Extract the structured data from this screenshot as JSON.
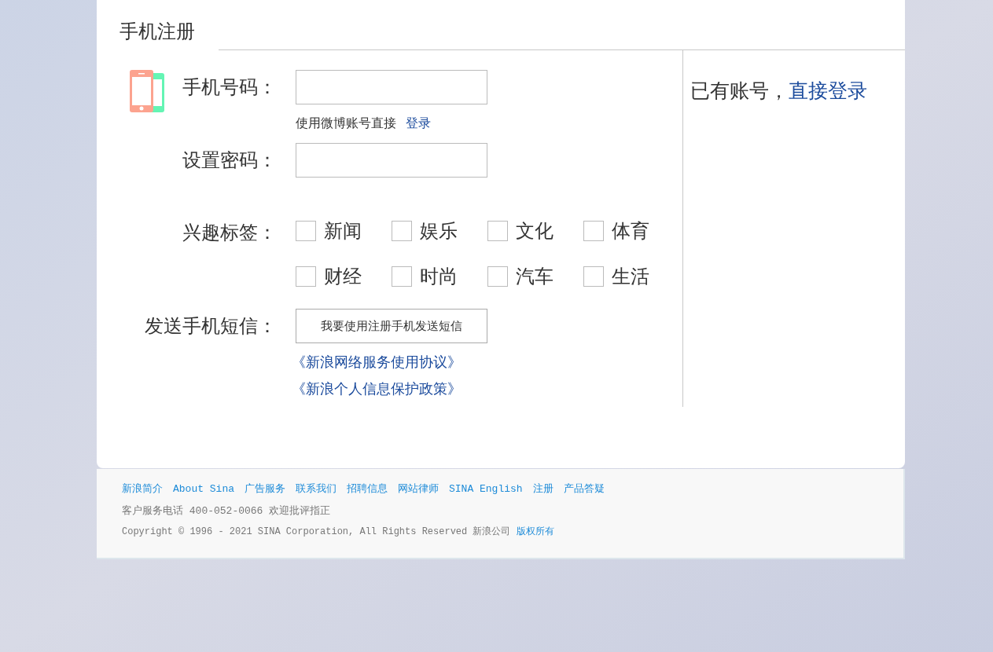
{
  "title": "手机注册",
  "fields": [
    {
      "label": "手机号码：",
      "kind": "input",
      "hint": "使用微博账号直接",
      "hint_link": "登录"
    },
    {
      "label": "设置密码：",
      "kind": "input"
    }
  ],
  "interests": {
    "label": "兴趣标签：",
    "tags": [
      {
        "label": "新闻",
        "checked": false
      },
      {
        "label": "娱乐",
        "checked": false
      },
      {
        "label": "文化",
        "checked": false
      },
      {
        "label": "体育",
        "checked": false
      },
      {
        "label": "财经",
        "checked": false
      },
      {
        "label": "时尚",
        "checked": false
      },
      {
        "label": "汽车",
        "checked": false
      },
      {
        "label": "生活",
        "checked": false
      }
    ]
  },
  "sms": {
    "label": "发送手机短信：",
    "button": "我要使用注册手机发送短信"
  },
  "agreements": [
    "《新浪网络服务使用协议》",
    "《新浪个人信息保护政策》"
  ],
  "side": {
    "text": "已有账号，",
    "link": "直接登录"
  },
  "footer": {
    "links": [
      "新浪简介",
      "About Sina",
      "广告服务",
      "联系我们",
      "招聘信息",
      "网站律师",
      "SINA English",
      "注册",
      "产品答疑"
    ],
    "phone": "客户服务电话 400-052-0066 欢迎批评指正",
    "copyright": "Copyright © 1996 - 2021 SINA Corporation, All Rights Reserved 新浪公司",
    "copyright_link": "版权所有"
  }
}
